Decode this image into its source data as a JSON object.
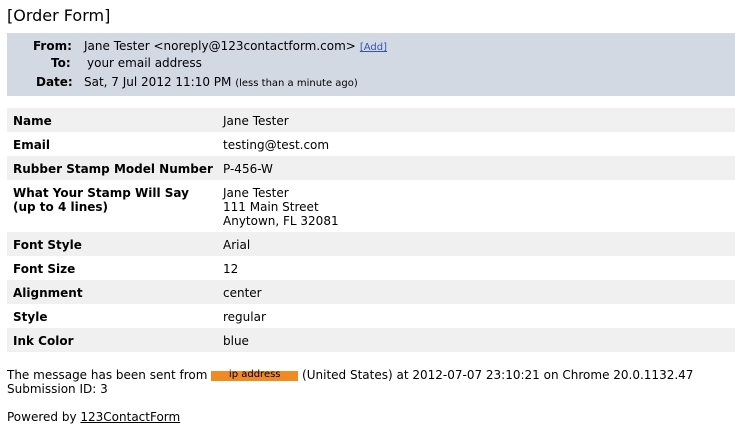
{
  "subject": "[Order Form]",
  "header": {
    "from_label": "From:",
    "from_value": "Jane Tester <noreply@123contactform.com>",
    "add_label": "[Add]",
    "to_label": "To:",
    "to_value": "your email address",
    "date_label": "Date:",
    "date_value": "Sat, 7 Jul 2012 11:10 PM",
    "date_relative": "(less than a minute ago)"
  },
  "fields": [
    {
      "name": "Name",
      "value": "Jane Tester"
    },
    {
      "name": "Email",
      "value": "testing@test.com"
    },
    {
      "name": "Rubber Stamp Model Number",
      "value": "P-456-W"
    },
    {
      "name": "What Your Stamp Will Say\n(up to 4 lines)",
      "value": "Jane Tester\n111 Main Street\nAnytown, FL 32081"
    },
    {
      "name": "Font Style",
      "value": "Arial"
    },
    {
      "name": "Font Size",
      "value": "12"
    },
    {
      "name": "Alignment",
      "value": "center"
    },
    {
      "name": "Style",
      "value": "regular"
    },
    {
      "name": "Ink Color",
      "value": "blue"
    }
  ],
  "footer": {
    "sent_prefix": "The message has been sent from",
    "ip_label": "ip address",
    "sent_suffix": "(United States) at 2012-07-07 23:10:21 on Chrome 20.0.1132.47",
    "submission_id": "Submission ID: 3",
    "powered_prefix": "Powered by",
    "powered_link": "123ContactForm"
  }
}
